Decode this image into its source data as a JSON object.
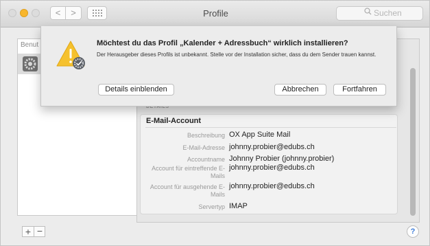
{
  "window": {
    "title": "Profile",
    "search_placeholder": "Suchen",
    "nav_back": "<",
    "nav_forward": ">",
    "accent_color": "#3a7ad8"
  },
  "sidebar": {
    "header": "Benut",
    "items": [
      {
        "icon": "gear-icon"
      }
    ]
  },
  "details": {
    "section_label": "DETAILS",
    "card_title": "E-Mail-Account",
    "rows": [
      {
        "key": "Beschreibung",
        "value": "OX App Suite Mail"
      },
      {
        "key": "E-Mail-Adresse",
        "value": "johnny.probier@edubs.ch"
      },
      {
        "key": "Accountname",
        "value": "Johnny Probier (johnny.probier)"
      },
      {
        "key": "Account für eintreffende E-Mails",
        "value": "johnny.probier@edubs.ch"
      },
      {
        "key": "Account für ausgehende E-Mails",
        "value": "johnny.probier@edubs.ch"
      },
      {
        "key": "Servertyp",
        "value": "IMAP"
      }
    ]
  },
  "footer": {
    "add_label": "+",
    "remove_label": "−",
    "help_label": "?"
  },
  "dialog": {
    "heading": "Möchtest du das Profil „Kalender + Adressbuch“ wirklich installieren?",
    "message": "Der Herausgeber dieses Profils ist unbekannt. Stelle vor der Installation sicher, dass du dem Sender trauen kannst.",
    "details_button": "Details einblenden",
    "cancel_button": "Abbrechen",
    "continue_button": "Fortfahren",
    "icon": "warning-profile-icon"
  }
}
